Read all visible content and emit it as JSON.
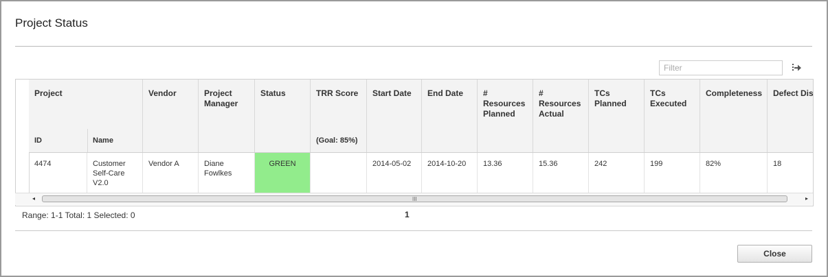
{
  "dialog": {
    "title": "Project Status"
  },
  "filter": {
    "placeholder": "Filter",
    "icon": "filter-apply-icon"
  },
  "table": {
    "headers": {
      "project": "Project",
      "id": "ID",
      "name": "Name",
      "vendor": "Vendor",
      "project_manager": "Project Manager",
      "status": "Status",
      "trr_score": "TRR Score",
      "trr_goal": "(Goal: 85%)",
      "start_date": "Start Date",
      "end_date": "End Date",
      "resources_planned": "# Resources Planned",
      "resources_actual": "# Resources Actual",
      "tcs_planned": "TCs Planned",
      "tcs_executed": "TCs Executed",
      "completeness": "Completeness",
      "defects_discovered": "Defect Discovere"
    },
    "rows": [
      {
        "id": "4474",
        "name": "Customer Self-Care V2.0",
        "vendor": "Vendor A",
        "project_manager": "Diane Fowlkes",
        "status": "GREEN",
        "trr_score": "",
        "start_date": "2014-05-02",
        "end_date": "2014-10-20",
        "resources_planned": "13.36",
        "resources_actual": "15.36",
        "tcs_planned": "242",
        "tcs_executed": "199",
        "completeness": "82%",
        "defects_discovered": "18"
      }
    ]
  },
  "scrollbar": {
    "left_arrow": "◂",
    "right_arrow": "▸",
    "grip": "III"
  },
  "footer": {
    "range_text": "Range: 1-1 Total: 1 Selected: 0",
    "page_number": "1",
    "close_label": "Close"
  },
  "colors": {
    "status_green": "#92ec8c"
  }
}
